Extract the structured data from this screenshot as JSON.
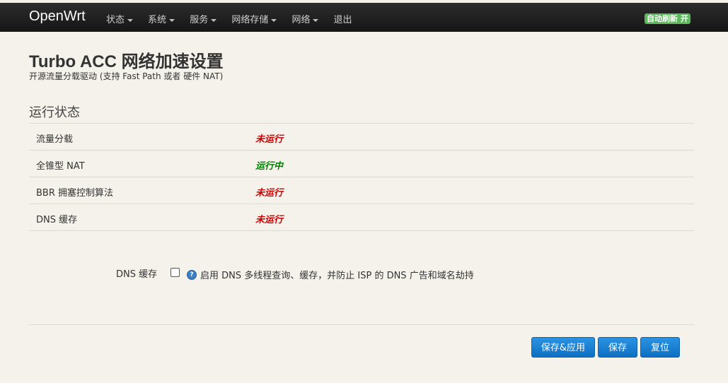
{
  "header": {
    "brand": "OpenWrt",
    "menu": [
      {
        "label": "状态",
        "dropdown": true
      },
      {
        "label": "系统",
        "dropdown": true
      },
      {
        "label": "服务",
        "dropdown": true
      },
      {
        "label": "网络存储",
        "dropdown": true
      },
      {
        "label": "网络",
        "dropdown": true
      },
      {
        "label": "退出",
        "dropdown": false
      }
    ],
    "auto_refresh": "自动刷新 开"
  },
  "page": {
    "title": "Turbo ACC 网络加速设置",
    "subtitle": "开源流量分载驱动 (支持 Fast Path 或者 硬件 NAT)"
  },
  "status": {
    "section_title": "运行状态",
    "rows": [
      {
        "label": "流量分载",
        "value": "未运行",
        "color": "#cc0000"
      },
      {
        "label": "全锥型 NAT",
        "value": "运行中",
        "color": "#008000"
      },
      {
        "label": "BBR 拥塞控制算法",
        "value": "未运行",
        "color": "#cc0000"
      },
      {
        "label": "DNS 缓存",
        "value": "未运行",
        "color": "#cc0000"
      }
    ]
  },
  "options": {
    "dns_cache": {
      "label": "DNS 缓存",
      "checked": false,
      "help_icon": "help-icon",
      "description": "启用 DNS 多线程查询、缓存，并防止 ISP 的 DNS 广告和域名劫持"
    }
  },
  "buttons": {
    "save_apply": "保存&应用",
    "save": "保存",
    "reset": "复位"
  },
  "colors": {
    "accent": "#1b82d6",
    "running": "#008000",
    "stopped": "#cc0000",
    "badge": "#5cb85c"
  }
}
